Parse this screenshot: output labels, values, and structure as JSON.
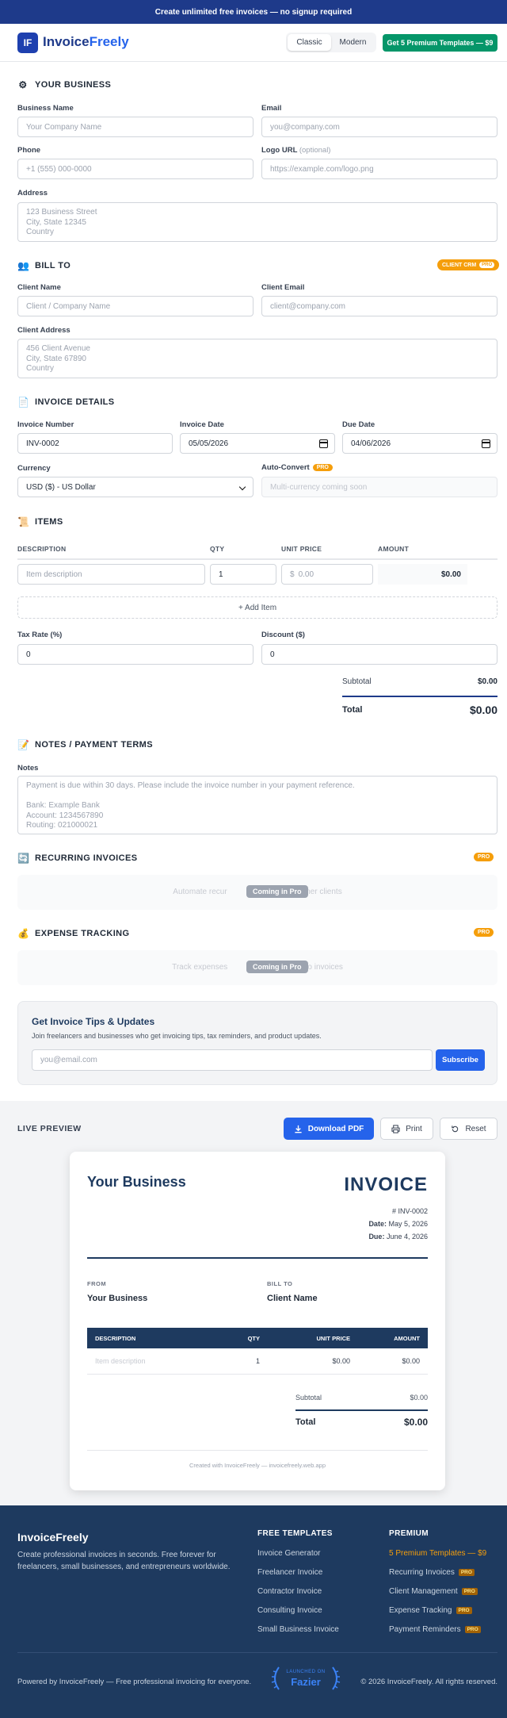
{
  "banner": "Create unlimited free invoices — no signup required",
  "nav": {
    "logo_badge": "IF",
    "logo_part1": "Invoice",
    "logo_part2": "Freely",
    "styles": [
      "Classic",
      "Modern"
    ],
    "active_style": "Classic",
    "premium_button": "Get 5 Premium Templates — $9"
  },
  "business": {
    "title": "YOUR BUSINESS",
    "icon": "gear-icon",
    "name_label": "Business Name",
    "name_placeholder": "Your Company Name",
    "email_label": "Email",
    "email_placeholder": "you@company.com",
    "phone_label": "Phone",
    "phone_placeholder": "+1 (555) 000-0000",
    "logo_label": "Logo URL",
    "logo_optional": "(optional)",
    "logo_placeholder": "https://example.com/logo.png",
    "address_label": "Address",
    "address_placeholder": "123 Business Street\nCity, State 12345\nCountry"
  },
  "client": {
    "title": "BILL TO",
    "icon": "people-icon",
    "crm_badge": "CLIENT CRM",
    "pro": "PRO",
    "name_label": "Client Name",
    "name_placeholder": "Client / Company Name",
    "email_label": "Client Email",
    "email_placeholder": "client@company.com",
    "address_label": "Client Address",
    "address_placeholder": "456 Client Avenue\nCity, State 67890\nCountry"
  },
  "details": {
    "title": "INVOICE DETAILS",
    "icon": "document-icon",
    "number_label": "Invoice Number",
    "number_value": "INV-0002",
    "date_label": "Invoice Date",
    "date_value": "05/05/2026",
    "due_label": "Due Date",
    "due_value": "04/06/2026",
    "currency_label": "Currency",
    "currency_value": "USD ($) - US Dollar",
    "autoconvert_label": "Auto-Convert",
    "autoconvert_pro": "PRO",
    "autoconvert_placeholder": "Multi-currency coming soon"
  },
  "items": {
    "title": "ITEMS",
    "icon": "scroll-icon",
    "headers": [
      "DESCRIPTION",
      "QTY",
      "UNIT PRICE",
      "AMOUNT"
    ],
    "row": {
      "desc_placeholder": "Item description",
      "qty": "1",
      "currency_symbol": "$",
      "price_placeholder": "0.00",
      "amount": "$0.00"
    },
    "add_item": "+ Add Item",
    "tax_label": "Tax Rate (%)",
    "tax_value": "0",
    "discount_label": "Discount ($)",
    "discount_value": "0",
    "subtotal_label": "Subtotal",
    "subtotal_value": "$0.00",
    "total_label": "Total",
    "total_value": "$0.00"
  },
  "notes": {
    "title": "NOTES / PAYMENT TERMS",
    "icon": "memo-icon",
    "label": "Notes",
    "placeholder": "Payment is due within 30 days. Please include the invoice number in your payment reference.\n\nBank: Example Bank\nAccount: 1234567890\nRouting: 021000021"
  },
  "recurring": {
    "title": "RECURRING INVOICES",
    "icon": "repeat-icon",
    "pro": "PRO",
    "text_left": "Automate recur",
    "text_right": "retainer clients",
    "badge": "Coming in Pro"
  },
  "expense": {
    "title": "EXPENSE TRACKING",
    "icon": "money-bag-icon",
    "pro": "PRO",
    "text_left": "Track expenses",
    "text_right": "ipts to invoices",
    "badge": "Coming in Pro"
  },
  "newsletter": {
    "title": "Get Invoice Tips & Updates",
    "text": "Join freelancers and businesses who get invoicing tips, tax reminders, and product updates.",
    "placeholder": "you@email.com",
    "button": "Subscribe"
  },
  "preview": {
    "title": "LIVE PREVIEW",
    "download": "Download PDF",
    "print": "Print",
    "reset": "Reset",
    "business": "Your Business",
    "heading": "INVOICE",
    "number": "# INV-0002",
    "date_label": "Date:",
    "date": "May 5, 2026",
    "due_label": "Due:",
    "due": "June 4, 2026",
    "from_label": "FROM",
    "from_name": "Your Business",
    "billto_label": "BILL TO",
    "billto_name": "Client Name",
    "headers": [
      "DESCRIPTION",
      "QTY",
      "UNIT PRICE",
      "AMOUNT"
    ],
    "row": {
      "desc": "Item description",
      "qty": "1",
      "price": "$0.00",
      "amount": "$0.00"
    },
    "subtotal_label": "Subtotal",
    "subtotal": "$0.00",
    "total_label": "Total",
    "total": "$0.00",
    "credit": "Created with InvoiceFreely — invoicefreely.web.app"
  },
  "footer": {
    "brand": "InvoiceFreely",
    "tagline": "Create professional invoices in seconds. Free forever for freelancers, small businesses, and entrepreneurs worldwide.",
    "col1_title": "FREE TEMPLATES",
    "col1_links": [
      "Invoice Generator",
      "Freelancer Invoice",
      "Contractor Invoice",
      "Consulting Invoice",
      "Small Business Invoice"
    ],
    "col2_title": "PREMIUM",
    "col2_highlight": "5 Premium Templates — $9",
    "col2_links": [
      "Recurring Invoices",
      "Client Management",
      "Expense Tracking",
      "Payment Reminders"
    ],
    "pro": "PRO",
    "powered": "Powered by InvoiceFreely — Free professional invoicing for everyone.",
    "fazier_small": "LAUNCHED ON",
    "fazier_big": "Fazier",
    "copyright": "© 2026 InvoiceFreely. All rights reserved."
  },
  "colors": {
    "navy": "#1e3a8a",
    "accent": "#2563eb",
    "green": "#059669",
    "amber": "#f59e0b",
    "footer": "#1e3a5f"
  }
}
